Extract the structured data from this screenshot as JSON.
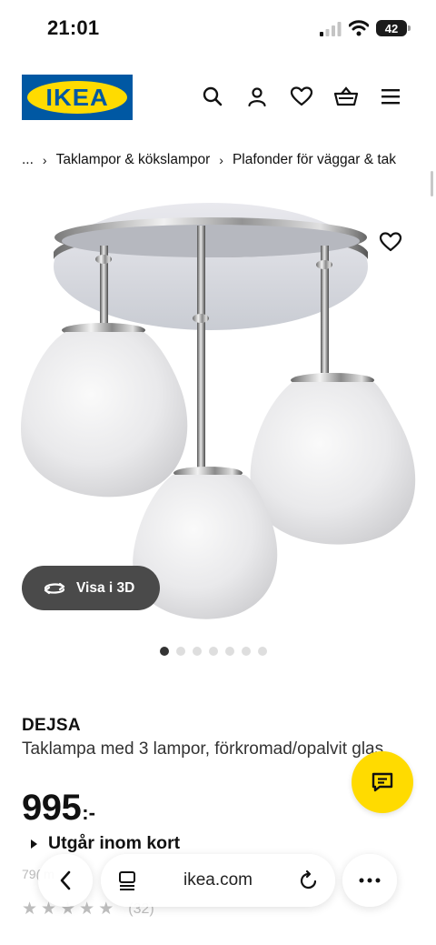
{
  "status": {
    "time": "21:01",
    "battery": "42"
  },
  "header": {
    "logo_text": "IKEA",
    "brand_blue": "#0058a3",
    "brand_yellow": "#ffdb00"
  },
  "breadcrumb": {
    "ellipsis": "...",
    "sep": "›",
    "items": [
      "Taklampor & kökslampor",
      "Plafonder för väggar & tak"
    ]
  },
  "gallery": {
    "view_3d_label": "Visa i 3D",
    "dot_count": 7,
    "active_index": 0
  },
  "product": {
    "name": "DEJSA",
    "description": "Taklampa med 3 lampor, förkromad/opalvit glas",
    "price_int": "995",
    "price_suffix": ":-",
    "availability": "Utgår inom kort",
    "faded_text": "79( m",
    "rating_stars": 5,
    "review_count": "(32)"
  },
  "browser": {
    "url": "ikea.com"
  },
  "icons": [
    "search-icon",
    "profile-icon",
    "heart-icon",
    "basket-icon",
    "menu-icon",
    "chat-icon",
    "back-icon",
    "tabs-icon",
    "reload-icon",
    "more-icon",
    "rotate-3d-icon"
  ]
}
